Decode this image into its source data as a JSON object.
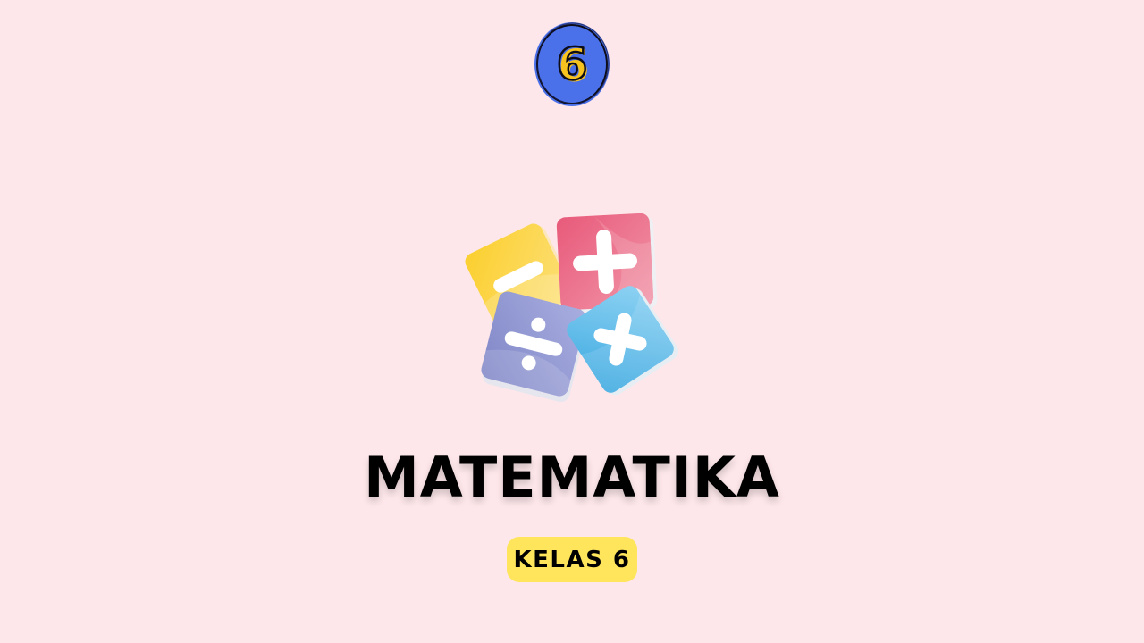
{
  "badge": {
    "digit": "6",
    "fill_color": "#4a70ea",
    "accent_color": "#f7c31f"
  },
  "illustration": {
    "tiles": [
      {
        "icon": "minus-icon",
        "color": "#f9c92a"
      },
      {
        "icon": "plus-icon",
        "color": "#ec6b86"
      },
      {
        "icon": "divide-icon",
        "color": "#8a91cb"
      },
      {
        "icon": "multiply-icon",
        "color": "#4fb3e6"
      }
    ]
  },
  "title": "MATEMATIKA",
  "subtitle_pill": {
    "label": "KELAS 6",
    "color": "#ffe55c"
  },
  "background_color": "#fde7ea"
}
